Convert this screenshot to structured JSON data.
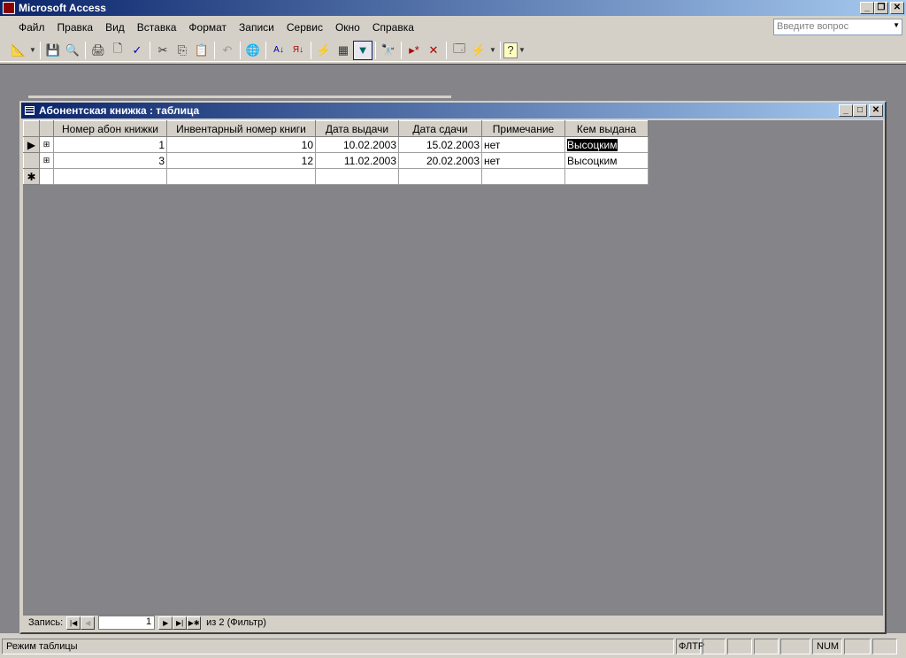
{
  "app": {
    "title": "Microsoft Access",
    "ask_placeholder": "Введите вопрос"
  },
  "menu": [
    "Файл",
    "Правка",
    "Вид",
    "Вставка",
    "Формат",
    "Записи",
    "Сервис",
    "Окно",
    "Справка"
  ],
  "toolbar_icons": [
    "view-icon",
    "save-icon",
    "search-icon",
    "print-icon",
    "print-preview-icon",
    "spelling-icon",
    "cut-icon",
    "copy-icon",
    "paste-icon",
    "undo-icon",
    "hyperlink-icon",
    "sort-asc-icon",
    "sort-desc-icon",
    "filter-by-selection-icon",
    "filter-by-form-icon",
    "apply-filter-icon",
    "find-icon",
    "new-record-icon",
    "delete-record-icon",
    "database-window-icon",
    "new-object-icon",
    "help-icon"
  ],
  "doc": {
    "title": "Абонентская книжка : таблица"
  },
  "table": {
    "columns": [
      "Номер абон книжки",
      "Инвентарный номер книги",
      "Дата выдачи",
      "Дата сдачи",
      "Примечание",
      "Кем выдана"
    ],
    "rows": [
      [
        "1",
        "10",
        "10.02.2003",
        "15.02.2003",
        "нет",
        "Высоцким"
      ],
      [
        "3",
        "12",
        "11.02.2003",
        "20.02.2003",
        "нет",
        "Высоцким"
      ]
    ]
  },
  "nav": {
    "label": "Запись:",
    "current": "1",
    "total": "из  2 (Фильтр)"
  },
  "status": {
    "mode": "Режим таблицы",
    "filter": "ФЛТР",
    "num": "NUM"
  }
}
